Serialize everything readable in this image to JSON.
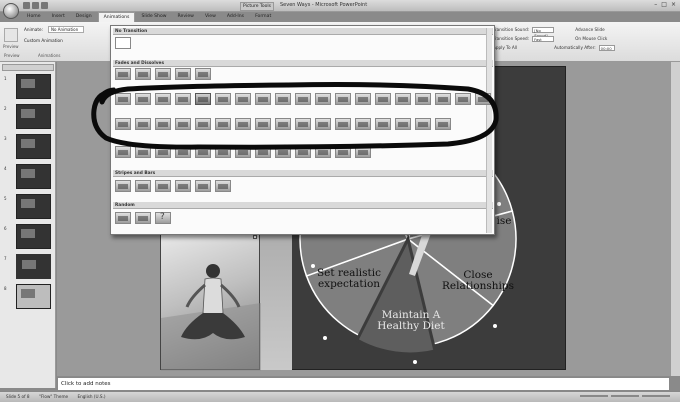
{
  "window": {
    "title": "Seven Ways - Microsoft PowerPoint",
    "context_tab": "Picture Tools",
    "controls": [
      "–",
      "□",
      "×"
    ]
  },
  "ribbon": {
    "tabs": [
      "Home",
      "Insert",
      "Design",
      "Animations",
      "Slide Show",
      "Review",
      "View",
      "Add-Ins",
      "Format"
    ],
    "active_tab": "Animations",
    "preview_label": "Preview",
    "animate_label": "Animate:",
    "animate_value": "No Animation",
    "custom_animation_label": "Custom Animation",
    "preview_group": "Preview",
    "animations_group": "Animations",
    "transition_sound_label": "Transition Sound:",
    "transition_sound_value": "[No Sound]",
    "transition_speed_label": "Transition Speed:",
    "transition_speed_value": "Fast",
    "apply_all_label": "Apply To All",
    "advance_slide_label": "Advance Slide",
    "on_mouse_click_label": "On Mouse Click",
    "auto_after_label": "Automatically After:",
    "auto_after_value": "00:00"
  },
  "gallery": {
    "sections": {
      "no_transition": "No Transition",
      "fades": "Fades and Dissolves",
      "stripes": "Stripes and Bars",
      "random": "Random"
    }
  },
  "slide_panel": {
    "numbers": [
      "1",
      "2",
      "3",
      "4",
      "5",
      "6",
      "7",
      "8"
    ]
  },
  "pie": {
    "labels": {
      "expectation": "Set realistic expectation",
      "relationships": "Close Relationships",
      "diet": "Maintain A Healthy Diet",
      "exercise": "ise"
    },
    "colors": {
      "slice": "#7f7f7f",
      "line": "#ffffff",
      "dark": "#3c3c3c"
    }
  },
  "notes": {
    "placeholder": "Click to add notes"
  },
  "status": {
    "slide_info": "Slide 5 of 8",
    "theme": "\"Flow\" Theme",
    "language": "English (U.S.)"
  }
}
